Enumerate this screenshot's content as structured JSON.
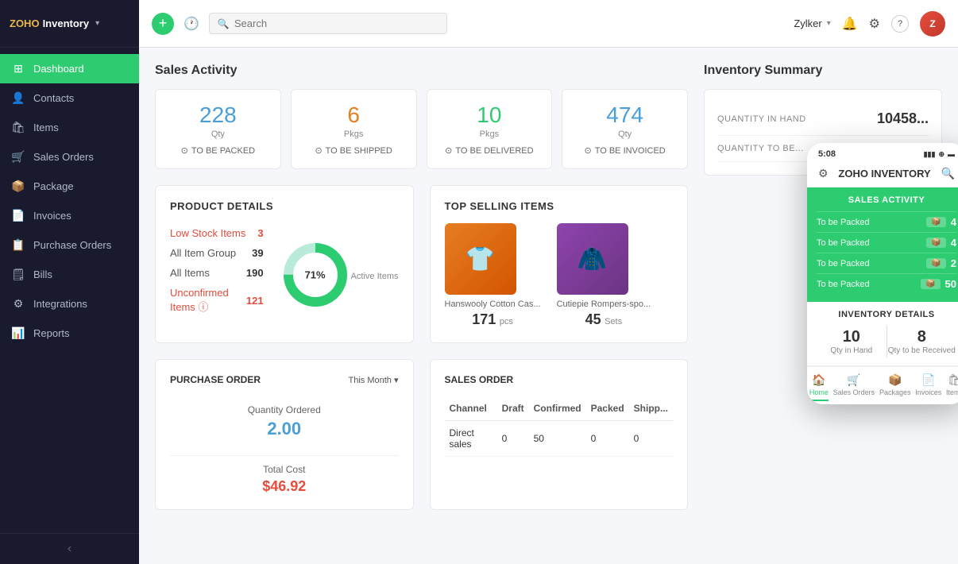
{
  "app": {
    "brand": "ZOHO",
    "name": "Inventory",
    "chevron": "▾"
  },
  "sidebar": {
    "items": [
      {
        "id": "dashboard",
        "label": "Dashboard",
        "icon": "⊞",
        "active": true
      },
      {
        "id": "contacts",
        "label": "Contacts",
        "icon": "👤"
      },
      {
        "id": "items",
        "label": "Items",
        "icon": "🛍"
      },
      {
        "id": "sales-orders",
        "label": "Sales Orders",
        "icon": "🛒"
      },
      {
        "id": "package",
        "label": "Package",
        "icon": "📦"
      },
      {
        "id": "invoices",
        "label": "Invoices",
        "icon": "📄"
      },
      {
        "id": "purchase-orders",
        "label": "Purchase Orders",
        "icon": "📋"
      },
      {
        "id": "bills",
        "label": "Bills",
        "icon": "🗒"
      },
      {
        "id": "integrations",
        "label": "Integrations",
        "icon": "⚙"
      },
      {
        "id": "reports",
        "label": "Reports",
        "icon": "📊"
      }
    ],
    "collapse_icon": "‹"
  },
  "header": {
    "search_placeholder": "Search",
    "user_name": "Zylker",
    "add_icon": "+",
    "clock_icon": "🕐",
    "bell_icon": "🔔",
    "settings_icon": "⚙",
    "help_icon": "?"
  },
  "sales_activity": {
    "title": "Sales Activity",
    "cards": [
      {
        "value": "228",
        "unit": "Qty",
        "label": "TO BE PACKED",
        "color": "blue"
      },
      {
        "value": "6",
        "unit": "Pkgs",
        "label": "TO BE SHIPPED",
        "color": "orange"
      },
      {
        "value": "10",
        "unit": "Pkgs",
        "label": "TO BE DELIVERED",
        "color": "teal"
      },
      {
        "value": "474",
        "unit": "Qty",
        "label": "TO BE INVOICED",
        "color": "blue"
      }
    ]
  },
  "inventory_summary": {
    "title": "Inventory Summary",
    "rows": [
      {
        "label": "QUANTITY IN HAND",
        "value": "10458..."
      },
      {
        "label": "QUANTITY TO BE...",
        "value": ""
      }
    ]
  },
  "product_details": {
    "title": "PRODUCT DETAILS",
    "rows": [
      {
        "label": "Low Stock Items",
        "value": "3",
        "red": true
      },
      {
        "label": "All Item Group",
        "value": "39",
        "red": false
      },
      {
        "label": "All Items",
        "value": "190",
        "red": false
      },
      {
        "label": "Unconfirmed Items ⓘ",
        "value": "121",
        "red": true
      }
    ],
    "active_items_label": "Active Items",
    "donut": {
      "percent": 71,
      "label": "71%",
      "color_filled": "#2ecc71",
      "color_empty": "#b8ebd9"
    }
  },
  "top_selling": {
    "title": "TOP SELLING ITEMS",
    "items": [
      {
        "name": "Hanswooly Cotton Cas...",
        "count": "171",
        "unit": "pcs",
        "color": "#e67e22"
      },
      {
        "name": "Cutiepie Rompers-spo...",
        "count": "45",
        "unit": "Sets",
        "color": "#9b59b6"
      }
    ]
  },
  "purchase_order": {
    "title": "PURCHASE ORDER",
    "filter": "This Month ▾",
    "qty_ordered_label": "Quantity Ordered",
    "qty_ordered_value": "2.00",
    "total_cost_label": "Total Cost",
    "total_cost_value": "$46.92"
  },
  "sales_order": {
    "title": "SALES ORDER",
    "columns": [
      "Channel",
      "Draft",
      "Confirmed",
      "Packed",
      "Shipp..."
    ],
    "rows": [
      {
        "channel": "Direct sales",
        "draft": "0",
        "confirmed": "50",
        "packed": "0",
        "shipped": "0"
      }
    ]
  },
  "mobile": {
    "time": "5:08",
    "app_name": "ZOHO INVENTORY",
    "sales_activity_title": "SALES ACTIVITY",
    "sa_rows": [
      {
        "label": "To be Packed",
        "badge": "📦",
        "value": "4"
      },
      {
        "label": "To be Packed",
        "badge": "📦",
        "value": "4"
      },
      {
        "label": "To be Packed",
        "badge": "📦",
        "value": "2"
      },
      {
        "label": "To be Packed",
        "badge": "📦",
        "value": "50"
      }
    ],
    "inv_details_title": "INVENTORY DETAILS",
    "qty_in_hand": "10",
    "qty_in_hand_label": "Qty in Hand",
    "qty_to_receive": "8",
    "qty_to_receive_label": "Qty to be Received",
    "nav": [
      "Home",
      "Sales Orders",
      "Packages",
      "Invoices",
      "Items"
    ]
  }
}
